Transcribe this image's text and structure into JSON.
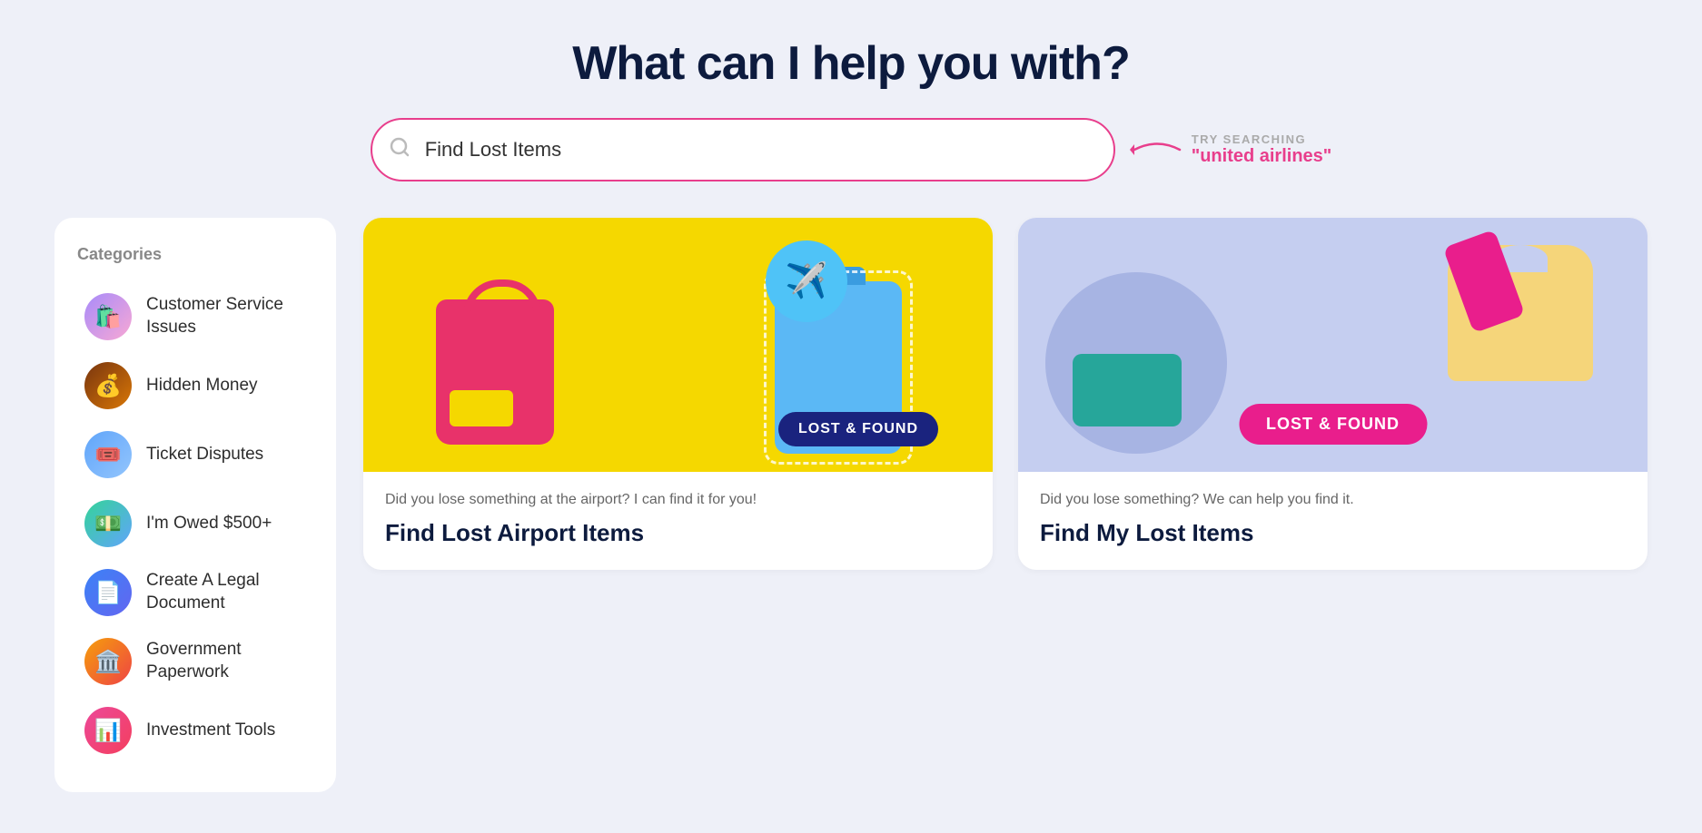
{
  "header": {
    "title": "What can I help you with?"
  },
  "search": {
    "value": "Find Lost Items",
    "placeholder": "Find Lost Items",
    "try_label": "TRY SEARCHING",
    "try_value": "\"united airlines\""
  },
  "sidebar": {
    "heading": "Categories",
    "items": [
      {
        "id": "customer-service",
        "label": "Customer Service Issues",
        "icon": "🛍️",
        "icon_class": "cat-icon-customer"
      },
      {
        "id": "hidden-money",
        "label": "Hidden Money",
        "icon": "💰",
        "icon_class": "cat-icon-hidden"
      },
      {
        "id": "ticket-disputes",
        "label": "Ticket Disputes",
        "icon": "🎟️",
        "icon_class": "cat-icon-ticket"
      },
      {
        "id": "owed-money",
        "label": "I'm Owed $500+",
        "icon": "💵",
        "icon_class": "cat-icon-owed"
      },
      {
        "id": "legal-document",
        "label": "Create A Legal Document",
        "icon": "📄",
        "icon_class": "cat-icon-legal"
      },
      {
        "id": "gov-paperwork",
        "label": "Government Paperwork",
        "icon": "🏛️",
        "icon_class": "cat-icon-gov"
      },
      {
        "id": "investment-tools",
        "label": "Investment Tools",
        "icon": "📊",
        "icon_class": "cat-icon-invest"
      }
    ]
  },
  "results": {
    "cards": [
      {
        "id": "airport-lost",
        "badge": "LOST & FOUND",
        "desc": "Did you lose something at the airport? I can find it for you!",
        "title": "Find Lost Airport Items"
      },
      {
        "id": "general-lost",
        "badge": "LOST & FOUND",
        "desc": "Did you lose something? We can help you find it.",
        "title": "Find My Lost Items"
      }
    ]
  }
}
